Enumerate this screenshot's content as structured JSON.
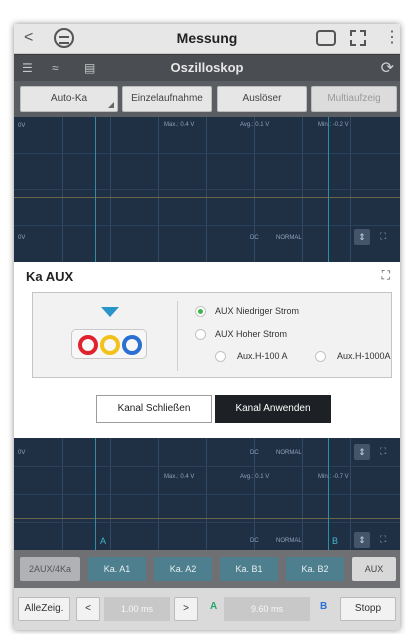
{
  "window": {
    "title": "Messung",
    "back_glyph": "<",
    "more_glyph": "⋮"
  },
  "toolbar": {
    "title": "Oszilloskop",
    "icons": [
      "settings-sliders-icon",
      "waveform-icon",
      "save-icon",
      "refresh-icon"
    ]
  },
  "modes": {
    "auto": "Auto-Ka",
    "single": "Einzelaufnahme",
    "trigger": "Auslöser",
    "multi": "Multiaufzeig"
  },
  "scope_top": {
    "max": "Max.: 0.4 V",
    "avg": "Avg.: 0.1 V",
    "min": "Min.: -0.2 V",
    "dc": "DC",
    "normal": "NORMAL",
    "top_scale": "0V",
    "bottom_scale": "0V"
  },
  "dialog": {
    "title": "Ka AUX",
    "options": {
      "low": "AUX Niedriger Strom",
      "high": "AUX Hoher Strom",
      "h100": "Aux.H-100 A",
      "h1000": "Aux.H-1000A"
    },
    "selected": "low",
    "close_label": "Kanal Schließen",
    "apply_label": "Kanal Anwenden"
  },
  "scope_bottom": {
    "dc": "DC",
    "normal": "NORMAL",
    "max": "Max.: 0.4 V",
    "avg": "Avg.: 0.1 V",
    "min": "Min.: -0.7 V",
    "marker_a": "A",
    "marker_b": "B",
    "scale": "0V"
  },
  "tabs": {
    "first": "2AUX/4Ka",
    "a1": "Ka. A1",
    "a2": "Ka. A2",
    "b1": "Ka. B1",
    "b2": "Ka. B2",
    "aux": "AUX"
  },
  "bottom": {
    "all": "AlleZeig.",
    "prev": "<",
    "time": "1.00 ms",
    "next": ">",
    "marker_a": "A",
    "delta": "9.60 ms",
    "marker_b": "B",
    "stop": "Stopp"
  },
  "colors": {
    "accent_green": "#3db54a",
    "tab_teal": "#4d7f8e",
    "scope_bg": "#1f2f44",
    "jack_red": "#e0232e",
    "jack_yellow": "#f2c21b",
    "jack_blue": "#2a6fd1"
  }
}
